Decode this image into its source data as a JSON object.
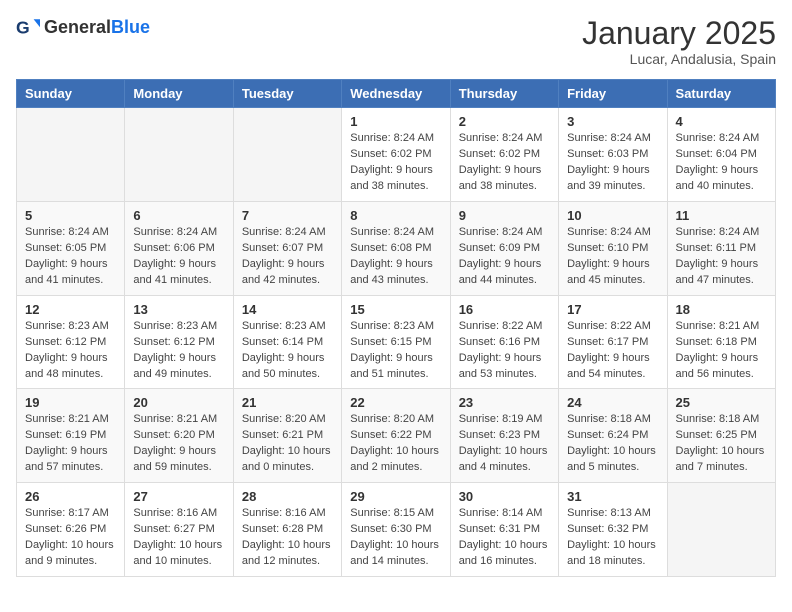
{
  "header": {
    "logo_general": "General",
    "logo_blue": "Blue",
    "month_title": "January 2025",
    "location": "Lucar, Andalusia, Spain"
  },
  "weekdays": [
    "Sunday",
    "Monday",
    "Tuesday",
    "Wednesday",
    "Thursday",
    "Friday",
    "Saturday"
  ],
  "weeks": [
    [
      {
        "day": "",
        "info": ""
      },
      {
        "day": "",
        "info": ""
      },
      {
        "day": "",
        "info": ""
      },
      {
        "day": "1",
        "info": "Sunrise: 8:24 AM\nSunset: 6:02 PM\nDaylight: 9 hours and 38 minutes."
      },
      {
        "day": "2",
        "info": "Sunrise: 8:24 AM\nSunset: 6:02 PM\nDaylight: 9 hours and 38 minutes."
      },
      {
        "day": "3",
        "info": "Sunrise: 8:24 AM\nSunset: 6:03 PM\nDaylight: 9 hours and 39 minutes."
      },
      {
        "day": "4",
        "info": "Sunrise: 8:24 AM\nSunset: 6:04 PM\nDaylight: 9 hours and 40 minutes."
      }
    ],
    [
      {
        "day": "5",
        "info": "Sunrise: 8:24 AM\nSunset: 6:05 PM\nDaylight: 9 hours and 41 minutes."
      },
      {
        "day": "6",
        "info": "Sunrise: 8:24 AM\nSunset: 6:06 PM\nDaylight: 9 hours and 41 minutes."
      },
      {
        "day": "7",
        "info": "Sunrise: 8:24 AM\nSunset: 6:07 PM\nDaylight: 9 hours and 42 minutes."
      },
      {
        "day": "8",
        "info": "Sunrise: 8:24 AM\nSunset: 6:08 PM\nDaylight: 9 hours and 43 minutes."
      },
      {
        "day": "9",
        "info": "Sunrise: 8:24 AM\nSunset: 6:09 PM\nDaylight: 9 hours and 44 minutes."
      },
      {
        "day": "10",
        "info": "Sunrise: 8:24 AM\nSunset: 6:10 PM\nDaylight: 9 hours and 45 minutes."
      },
      {
        "day": "11",
        "info": "Sunrise: 8:24 AM\nSunset: 6:11 PM\nDaylight: 9 hours and 47 minutes."
      }
    ],
    [
      {
        "day": "12",
        "info": "Sunrise: 8:23 AM\nSunset: 6:12 PM\nDaylight: 9 hours and 48 minutes."
      },
      {
        "day": "13",
        "info": "Sunrise: 8:23 AM\nSunset: 6:12 PM\nDaylight: 9 hours and 49 minutes."
      },
      {
        "day": "14",
        "info": "Sunrise: 8:23 AM\nSunset: 6:14 PM\nDaylight: 9 hours and 50 minutes."
      },
      {
        "day": "15",
        "info": "Sunrise: 8:23 AM\nSunset: 6:15 PM\nDaylight: 9 hours and 51 minutes."
      },
      {
        "day": "16",
        "info": "Sunrise: 8:22 AM\nSunset: 6:16 PM\nDaylight: 9 hours and 53 minutes."
      },
      {
        "day": "17",
        "info": "Sunrise: 8:22 AM\nSunset: 6:17 PM\nDaylight: 9 hours and 54 minutes."
      },
      {
        "day": "18",
        "info": "Sunrise: 8:21 AM\nSunset: 6:18 PM\nDaylight: 9 hours and 56 minutes."
      }
    ],
    [
      {
        "day": "19",
        "info": "Sunrise: 8:21 AM\nSunset: 6:19 PM\nDaylight: 9 hours and 57 minutes."
      },
      {
        "day": "20",
        "info": "Sunrise: 8:21 AM\nSunset: 6:20 PM\nDaylight: 9 hours and 59 minutes."
      },
      {
        "day": "21",
        "info": "Sunrise: 8:20 AM\nSunset: 6:21 PM\nDaylight: 10 hours and 0 minutes."
      },
      {
        "day": "22",
        "info": "Sunrise: 8:20 AM\nSunset: 6:22 PM\nDaylight: 10 hours and 2 minutes."
      },
      {
        "day": "23",
        "info": "Sunrise: 8:19 AM\nSunset: 6:23 PM\nDaylight: 10 hours and 4 minutes."
      },
      {
        "day": "24",
        "info": "Sunrise: 8:18 AM\nSunset: 6:24 PM\nDaylight: 10 hours and 5 minutes."
      },
      {
        "day": "25",
        "info": "Sunrise: 8:18 AM\nSunset: 6:25 PM\nDaylight: 10 hours and 7 minutes."
      }
    ],
    [
      {
        "day": "26",
        "info": "Sunrise: 8:17 AM\nSunset: 6:26 PM\nDaylight: 10 hours and 9 minutes."
      },
      {
        "day": "27",
        "info": "Sunrise: 8:16 AM\nSunset: 6:27 PM\nDaylight: 10 hours and 10 minutes."
      },
      {
        "day": "28",
        "info": "Sunrise: 8:16 AM\nSunset: 6:28 PM\nDaylight: 10 hours and 12 minutes."
      },
      {
        "day": "29",
        "info": "Sunrise: 8:15 AM\nSunset: 6:30 PM\nDaylight: 10 hours and 14 minutes."
      },
      {
        "day": "30",
        "info": "Sunrise: 8:14 AM\nSunset: 6:31 PM\nDaylight: 10 hours and 16 minutes."
      },
      {
        "day": "31",
        "info": "Sunrise: 8:13 AM\nSunset: 6:32 PM\nDaylight: 10 hours and 18 minutes."
      },
      {
        "day": "",
        "info": ""
      }
    ]
  ]
}
